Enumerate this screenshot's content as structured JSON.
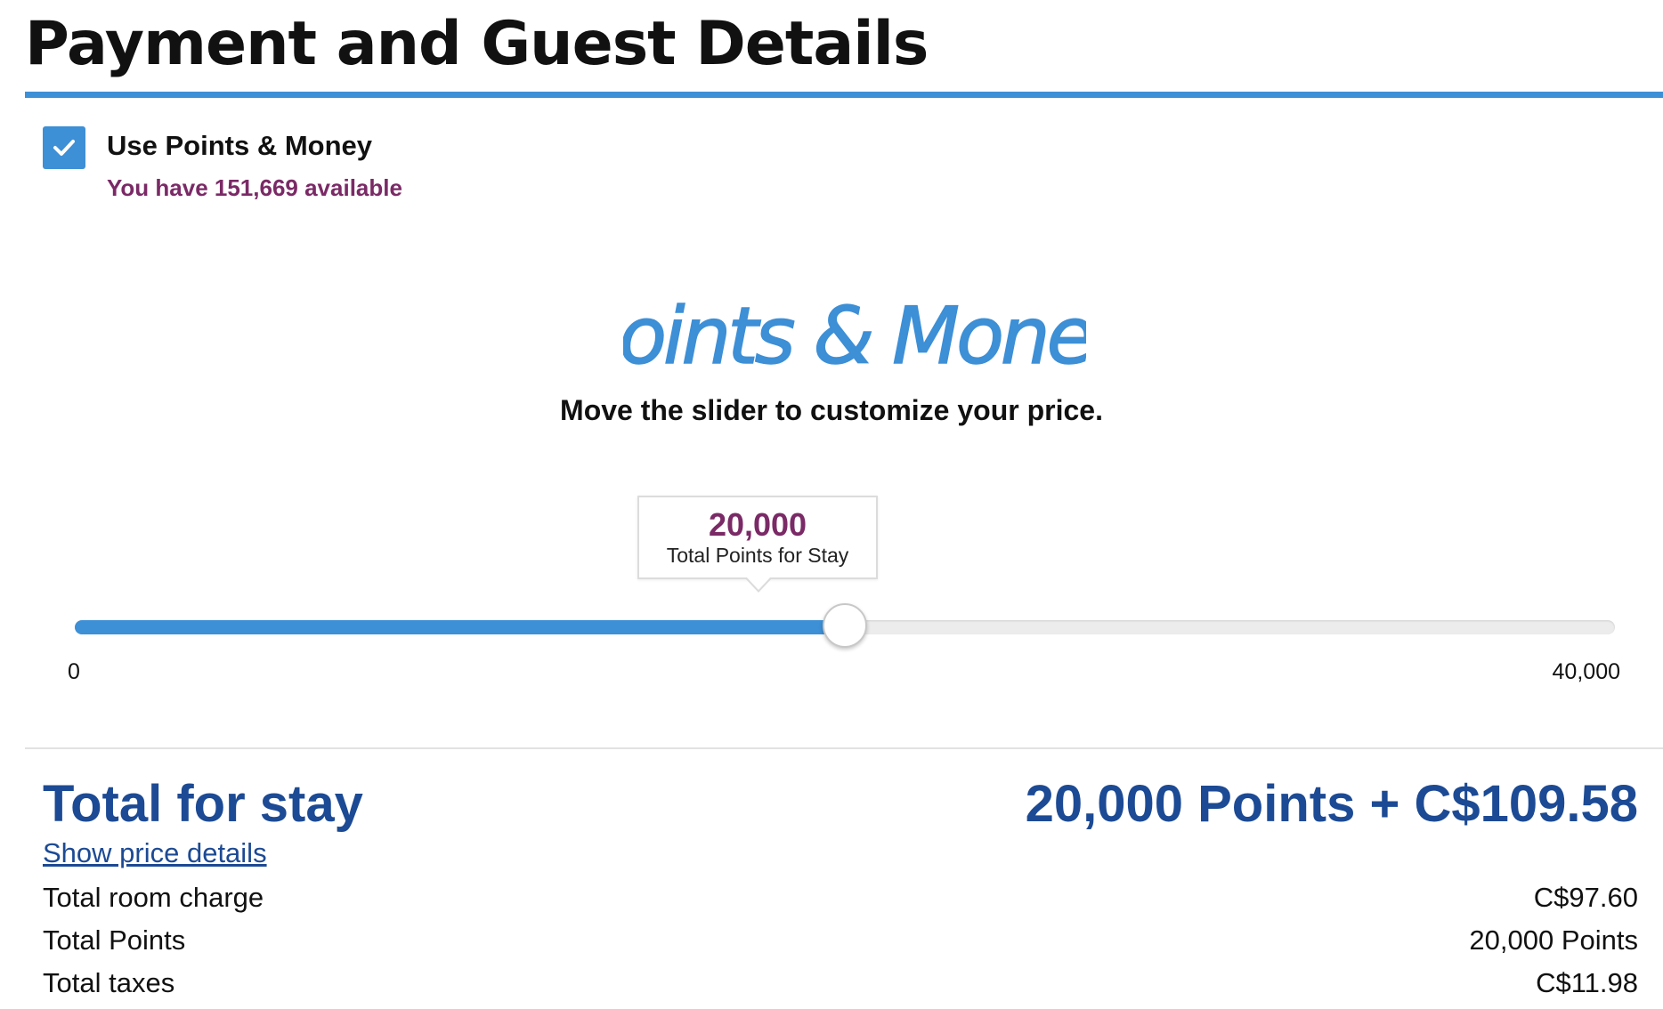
{
  "header": {
    "title": "Payment and Guest Details"
  },
  "points_option": {
    "checked": true,
    "label": "Use Points & Money",
    "available_text": "You have 151,669 available"
  },
  "logo": {
    "text": "Points & Money",
    "color": "#3d8fd6"
  },
  "instruction": "Move the slider to customize your price.",
  "slider": {
    "min": 0,
    "max": 40000,
    "value": 20000,
    "min_label": "0",
    "max_label": "40,000",
    "tooltip_value": "20,000",
    "tooltip_label": "Total Points for Stay"
  },
  "summary": {
    "heading": "Total for stay",
    "total": "20,000 Points + C$109.58",
    "details_link": "Show price details",
    "rows": [
      {
        "label": "Total room charge",
        "value": "C$97.60"
      },
      {
        "label": "Total Points",
        "value": "20,000 Points"
      },
      {
        "label": "Total taxes",
        "value": "C$11.98"
      }
    ]
  },
  "colors": {
    "accent": "#3d8fd6",
    "points_purple": "#7a2a66",
    "total_navy": "#1c4a94"
  }
}
